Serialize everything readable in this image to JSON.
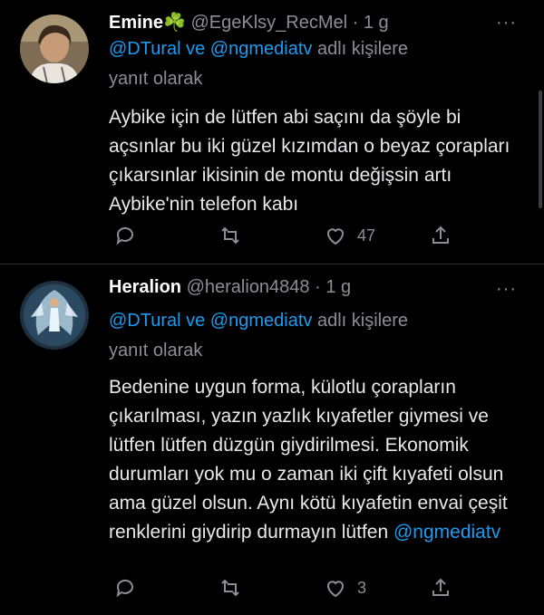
{
  "tweets": [
    {
      "display_name": "Emine",
      "name_emoji": "☘️",
      "handle": "@EgeKlsy_RecMel",
      "time": "· 1 g",
      "reply_mentions": "@DTural ve @ngmediatv",
      "reply_suffix": "adlı kişilere",
      "reply_line2": "yanıt olarak",
      "body": "Aybike için de lütfen abi saçını da şöyle bi açsınlar bu iki güzel kızımdan o beyaz çorapları çıkarsınlar ikisinin de montu değişsin artı Aybike'nin telefon kabı",
      "likes": "47"
    },
    {
      "display_name": "Heralion",
      "handle": "@heralion4848",
      "time": "· 1 g",
      "reply_mentions": "@DTural ve @ngmediatv",
      "reply_suffix": "adlı kişilere",
      "reply_line2": "yanıt olarak",
      "body": "Bedenine uygun forma, külotlu çorapların çıkarılması, yazın yazlık kıyafetler giymesi ve lütfen lütfen düzgün giydirilmesi. Ekonomik durumları yok mu o zaman iki çift kıyafeti olsun ama güzel olsun. Aynı kötü kıyafetin envai çeşit renklerini giydirip durmayın lütfen",
      "body_mention": "@ngmediatv",
      "likes": "3"
    }
  ],
  "more_glyph": "···",
  "colors": {
    "background": "#000000",
    "text": "#e7e9ea",
    "muted": "#8b8f94",
    "accent": "#1d9bf0"
  },
  "icons": [
    "reply-icon",
    "retweet-icon",
    "like-icon",
    "share-icon",
    "more-icon",
    "clover-emoji"
  ]
}
